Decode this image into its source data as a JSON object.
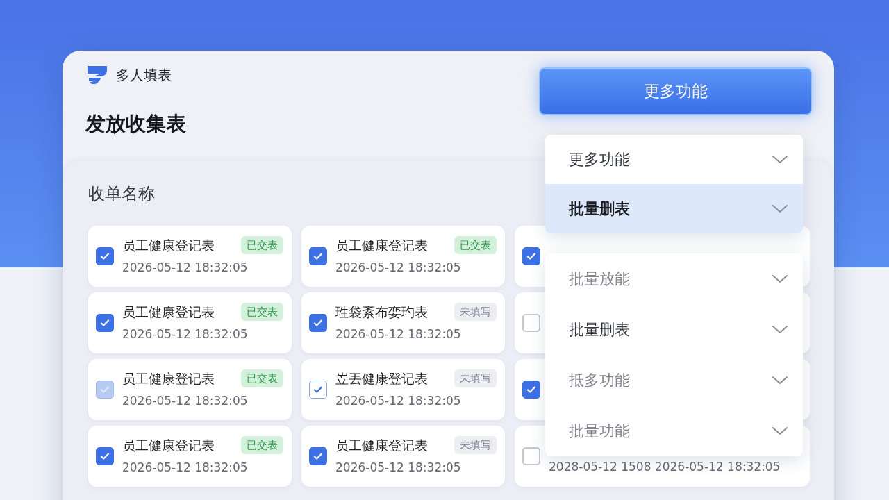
{
  "app": {
    "name": "多人填表"
  },
  "page_title": "发放收集表",
  "more_button": {
    "label": "更多功能"
  },
  "panel": {
    "heading": "收单名称",
    "cards": [
      {
        "checkbox": {
          "checked": true,
          "kind": "solid"
        },
        "title": "员工健康登记表",
        "tag": {
          "label": "已交表",
          "kind": "done"
        },
        "date": "2026-05-12 18:32:05"
      },
      {
        "checkbox": {
          "checked": true,
          "kind": "solid"
        },
        "title": "员工健康登记表",
        "tag": {
          "label": "已交表",
          "kind": "done"
        },
        "date": "2026-05-12 18:32:05"
      },
      {
        "checkbox": {
          "checked": true,
          "kind": "solid"
        }
      },
      {
        "checkbox": {
          "checked": true,
          "kind": "solid"
        },
        "title": "员工健康登记表",
        "tag": {
          "label": "已交表",
          "kind": "done"
        },
        "date": "2026-05-12 18:32:05"
      },
      {
        "checkbox": {
          "checked": true,
          "kind": "solid"
        },
        "title": "珄袋紊布娈玓表",
        "tag": {
          "label": "未填写",
          "kind": "todo"
        },
        "date": "2026-05-12 18:32:05"
      },
      {
        "checkbox": {
          "checked": false,
          "kind": "solid"
        }
      },
      {
        "checkbox": {
          "checked": true,
          "kind": "faded"
        },
        "title": "员工健康登记表",
        "tag": {
          "label": "已交表",
          "kind": "done"
        },
        "date": "2026-05-12 18:32:05"
      },
      {
        "checkbox": {
          "checked": true,
          "kind": "outline"
        },
        "title": "岦丟健康登记表",
        "tag": {
          "label": "未填写",
          "kind": "todo"
        },
        "date": "2026-05-12 18:32:05"
      },
      {
        "checkbox": {
          "checked": true,
          "kind": "solid"
        }
      },
      {
        "checkbox": {
          "checked": true,
          "kind": "solid"
        },
        "title": "员工健康登记表",
        "tag": {
          "label": "已交表",
          "kind": "done"
        },
        "date": "2026-05-12 18:32:05"
      },
      {
        "checkbox": {
          "checked": true,
          "kind": "solid"
        },
        "title": "员工健康登记表",
        "tag": {
          "label": "未填写",
          "kind": "todo"
        },
        "date": "2026-05-12 18:32:05"
      },
      {
        "checkbox": {
          "checked": false,
          "kind": "solid"
        },
        "date": "2028-05-12 1508 2026-05-12 18:32:05"
      }
    ]
  },
  "menus": [
    {
      "items": [
        {
          "label": "更多功能",
          "selected": false,
          "disabled": false
        },
        {
          "label": "批量删表",
          "selected": true,
          "disabled": false
        }
      ]
    },
    {
      "items": [
        {
          "label": "批量放能",
          "selected": false,
          "disabled": true
        },
        {
          "label": "批量删表",
          "selected": false,
          "disabled": false
        },
        {
          "label": "抵多功能",
          "selected": false,
          "disabled": true
        },
        {
          "label": "批量功能",
          "selected": false,
          "disabled": true
        }
      ]
    }
  ]
}
